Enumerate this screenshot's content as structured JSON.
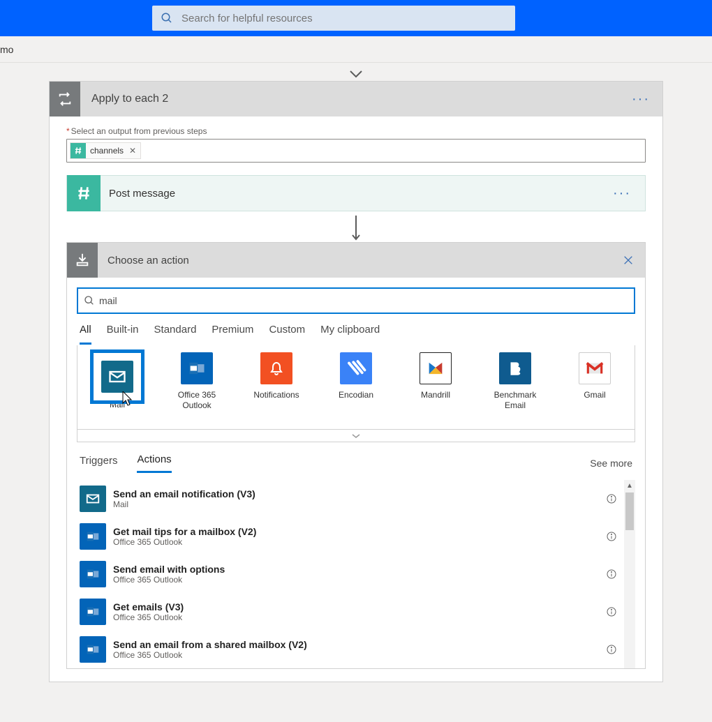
{
  "header": {
    "search_placeholder": "Search for helpful resources"
  },
  "breadcrumb": "mo",
  "applyToEach": {
    "title": "Apply to each 2",
    "field_label": "Select an output from previous steps",
    "token_label": "channels"
  },
  "postMessage": {
    "title": "Post message"
  },
  "chooseAction": {
    "title": "Choose an action",
    "search_value": "mail",
    "tabs": [
      "All",
      "Built-in",
      "Standard",
      "Premium",
      "Custom",
      "My clipboard"
    ],
    "active_tab": "All",
    "connectors": [
      {
        "label": "Mail",
        "key": "mail",
        "color": "#126a8a"
      },
      {
        "label": "Office 365 Outlook",
        "key": "o365",
        "color": "#0364b8"
      },
      {
        "label": "Notifications",
        "key": "notif",
        "color": "#f25022"
      },
      {
        "label": "Encodian",
        "key": "enc",
        "color": "#3a82f7"
      },
      {
        "label": "Mandrill",
        "key": "mandrill",
        "color": "#ffffff"
      },
      {
        "label": "Benchmark Email",
        "key": "bench",
        "color": "#0f5b8f"
      },
      {
        "label": "Gmail",
        "key": "gmail",
        "color": "#ffffff"
      }
    ],
    "selected_connector": "mail",
    "ta_tabs": [
      "Triggers",
      "Actions"
    ],
    "ta_active": "Actions",
    "see_more": "See more",
    "actions": [
      {
        "title": "Send an email notification (V3)",
        "connector": "Mail",
        "icon": "mail"
      },
      {
        "title": "Get mail tips for a mailbox (V2)",
        "connector": "Office 365 Outlook",
        "icon": "o365"
      },
      {
        "title": "Send email with options",
        "connector": "Office 365 Outlook",
        "icon": "o365"
      },
      {
        "title": "Get emails (V3)",
        "connector": "Office 365 Outlook",
        "icon": "o365"
      },
      {
        "title": "Send an email from a shared mailbox (V2)",
        "connector": "Office 365 Outlook",
        "icon": "o365"
      }
    ]
  }
}
